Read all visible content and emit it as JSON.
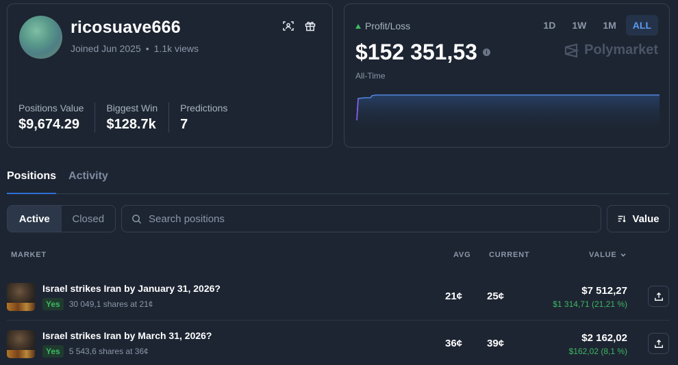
{
  "profile": {
    "username": "ricosuave666",
    "joined": "Joined Jun 2025",
    "views": "1.1k views",
    "stats": [
      {
        "label": "Positions Value",
        "value": "$9,674.29"
      },
      {
        "label": "Biggest Win",
        "value": "$128.7k"
      },
      {
        "label": "Predictions",
        "value": "7"
      }
    ]
  },
  "pnl": {
    "label": "Profit/Loss",
    "value": "$152 351,53",
    "range": "All-Time",
    "brand": "Polymarket",
    "timeframes": [
      "1D",
      "1W",
      "1M",
      "ALL"
    ],
    "active_timeframe": "ALL",
    "colors": {
      "line": "#4f86e0",
      "up": "#3fb863",
      "accent": "#5b9bf0"
    }
  },
  "tabs": [
    "Positions",
    "Activity"
  ],
  "filters": {
    "segments": [
      "Active",
      "Closed"
    ],
    "search_placeholder": "Search positions",
    "sort_label": "Value"
  },
  "table": {
    "headers": {
      "market": "MARKET",
      "avg": "AVG",
      "current": "CURRENT",
      "value": "VALUE"
    },
    "rows": [
      {
        "title": "Israel strikes Iran by January 31, 2026?",
        "outcome": "Yes",
        "shares": "30 049,1 shares at 21¢",
        "avg": "21¢",
        "current": "25¢",
        "value": "$7 512,27",
        "change": "$1 314,71 (21,21 %)"
      },
      {
        "title": "Israel strikes Iran by March 31, 2026?",
        "outcome": "Yes",
        "shares": "5 543,6 shares at 36¢",
        "avg": "36¢",
        "current": "39¢",
        "value": "$2 162,02",
        "change": "$162,02 (8,1 %)"
      }
    ]
  }
}
